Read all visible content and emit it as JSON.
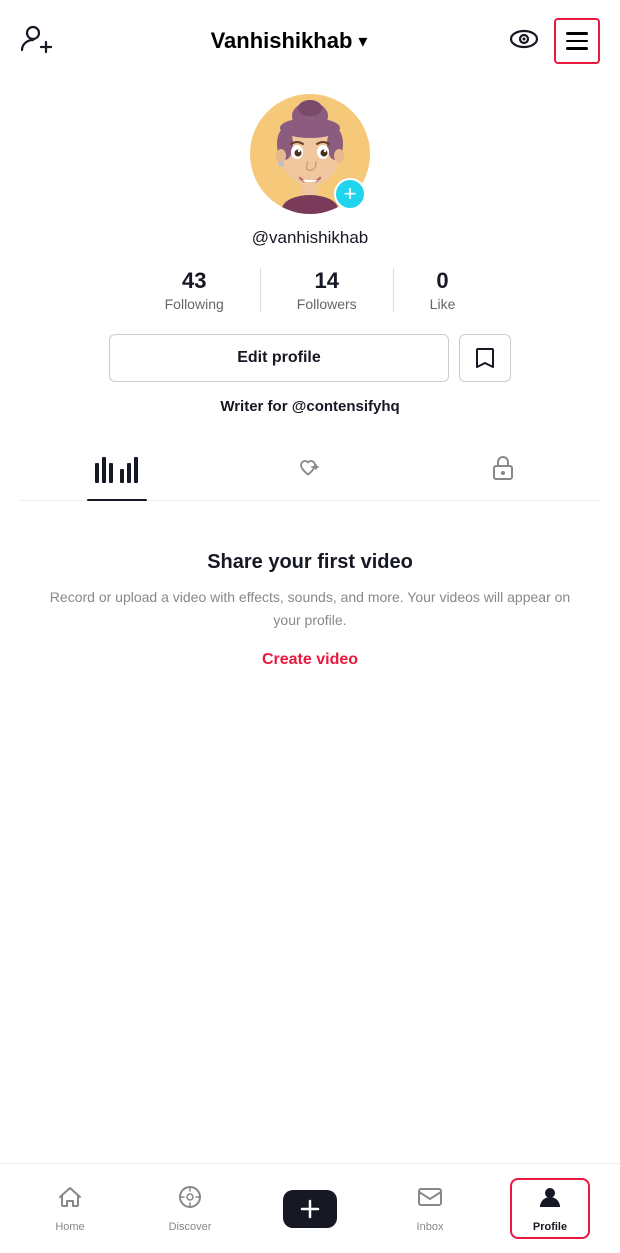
{
  "app": {
    "title": "Vanhishikhab",
    "title_dropdown": "▾"
  },
  "header": {
    "username_handle": "@vanhishikhab",
    "add_friend_label": "add-friend",
    "eye_label": "eye",
    "menu_label": "menu"
  },
  "stats": {
    "following_count": "43",
    "following_label": "Following",
    "followers_count": "14",
    "followers_label": "Followers",
    "likes_count": "0",
    "likes_label": "Like"
  },
  "buttons": {
    "edit_profile": "Edit profile",
    "bookmark": "🔖"
  },
  "bio": {
    "text": "Writer for ",
    "mention": "@contensifyhq"
  },
  "tabs": [
    {
      "id": "videos",
      "label": "videos",
      "active": true
    },
    {
      "id": "liked",
      "label": "liked",
      "active": false
    },
    {
      "id": "private",
      "label": "private",
      "active": false
    }
  ],
  "empty_state": {
    "title": "Share your first video",
    "description": "Record or upload a video with effects, sounds, and more. Your videos will appear on your profile.",
    "cta": "Create video"
  },
  "bottom_nav": [
    {
      "id": "home",
      "label": "Home",
      "active": false
    },
    {
      "id": "discover",
      "label": "Discover",
      "active": false
    },
    {
      "id": "post",
      "label": "Post",
      "active": false,
      "special": true
    },
    {
      "id": "inbox",
      "label": "Inbox",
      "active": false
    },
    {
      "id": "profile",
      "label": "Profile",
      "active": true,
      "highlighted": true
    }
  ],
  "colors": {
    "accent_red": "#e8193c",
    "accent_cyan": "#20d5ec",
    "active_black": "#161823",
    "inactive_grey": "#888888"
  }
}
